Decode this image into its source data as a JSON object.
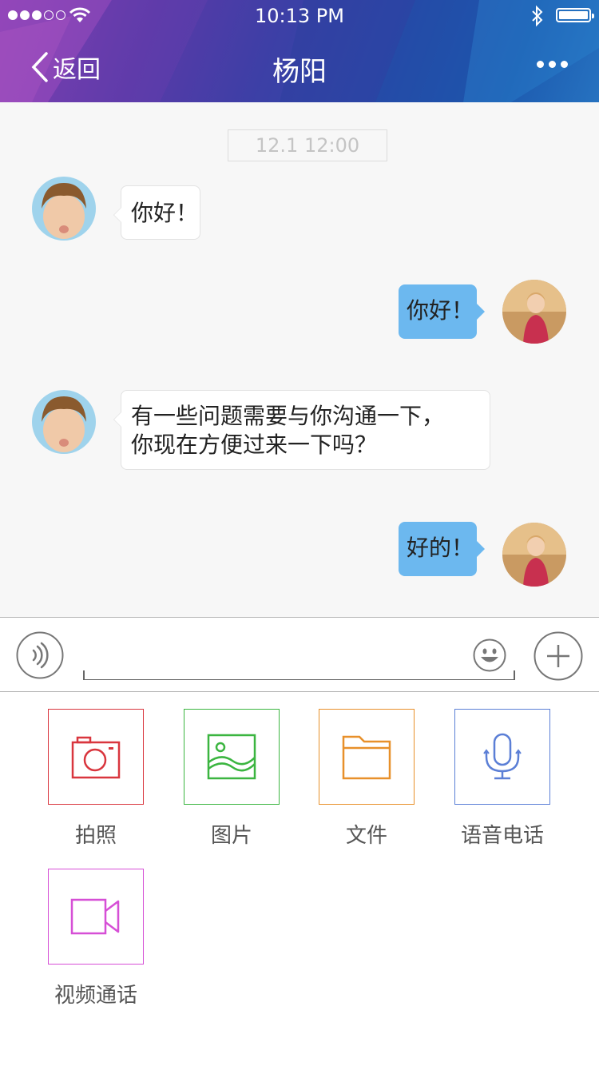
{
  "status_bar": {
    "time": "10:13 PM",
    "signal_bars_filled": 3,
    "signal_bars_total": 5
  },
  "nav": {
    "back_label": "返回",
    "title": "杨阳"
  },
  "chat": {
    "timestamp": "12.1 12:00",
    "messages": [
      {
        "direction": "incoming",
        "text": "你好！"
      },
      {
        "direction": "outgoing",
        "text": "你好！"
      },
      {
        "direction": "incoming",
        "lines": [
          "有一些问题需要与你沟通一下，",
          "你现在方便过来一下吗？"
        ]
      },
      {
        "direction": "outgoing",
        "text": "好的！"
      }
    ]
  },
  "input": {
    "placeholder": ""
  },
  "tools": [
    {
      "label": "拍照",
      "icon": "camera-icon",
      "color": "#d9363e"
    },
    {
      "label": "图片",
      "icon": "image-icon",
      "color": "#3bb540"
    },
    {
      "label": "文件",
      "icon": "folder-icon",
      "color": "#e8902a"
    },
    {
      "label": "语音电话",
      "icon": "microphone-icon",
      "color": "#5b7fd6"
    },
    {
      "label": "视频通话",
      "icon": "video-camera-icon",
      "color": "#d64fd6"
    }
  ],
  "colors": {
    "outgoing_bubble": "#6cb8ef",
    "chat_background": "#f7f7f7"
  }
}
